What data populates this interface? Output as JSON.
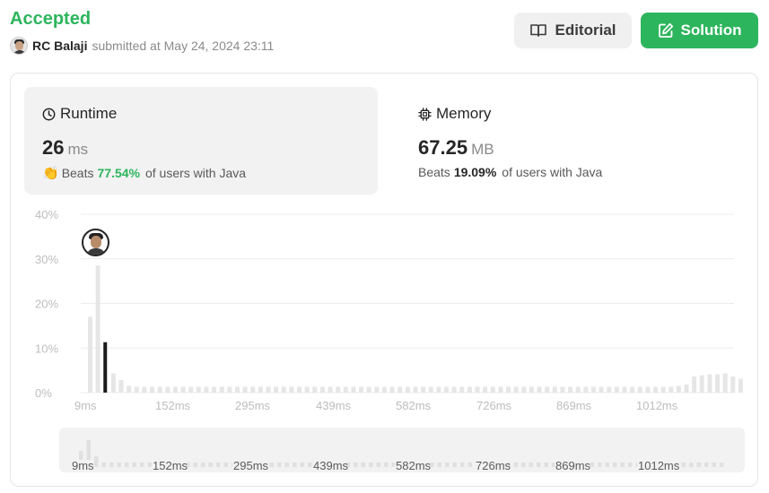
{
  "header": {
    "status": "Accepted",
    "submitter_name": "RC Balaji",
    "submitted_text": "submitted at May 24, 2024 23:11",
    "editorial_label": "Editorial",
    "solution_label": "Solution"
  },
  "runtime": {
    "title": "Runtime",
    "value": "26",
    "unit": "ms",
    "beats_prefix": "Beats",
    "beats_pct": "77.54%",
    "beats_suffix": "of users with Java"
  },
  "memory": {
    "title": "Memory",
    "value": "67.25",
    "unit": "MB",
    "beats_prefix": "Beats",
    "beats_pct": "19.09%",
    "beats_suffix": "of users with Java"
  },
  "colors": {
    "accent_green": "#2db55d",
    "bar_highlight": "#1a1a1a",
    "bar_muted": "#e6e6e6"
  },
  "icons": {
    "editorial": "book-icon",
    "solution": "edit-icon",
    "runtime": "clock-icon",
    "memory": "chip-icon",
    "beats": "clapping-hands-icon"
  },
  "chart_data": {
    "type": "bar",
    "xlabel": "",
    "ylabel": "",
    "ylim": [
      0,
      40
    ],
    "y_ticks": [
      "0%",
      "10%",
      "20%",
      "30%",
      "40%"
    ],
    "x_ticks": [
      "9ms",
      "152ms",
      "295ms",
      "439ms",
      "582ms",
      "726ms",
      "869ms",
      "1012ms"
    ],
    "grid": true,
    "highlight_index": 2,
    "values": [
      17,
      28.5,
      11.3,
      4.3,
      2.8,
      1.5,
      1.3,
      1.3,
      1.3,
      1.3,
      1.3,
      1.3,
      1.3,
      1.3,
      1.3,
      1.3,
      1.3,
      1.3,
      1.3,
      1.3,
      1.3,
      1.3,
      1.3,
      1.3,
      1.3,
      1.3,
      1.3,
      1.3,
      1.3,
      1.3,
      1.3,
      1.3,
      1.3,
      1.3,
      1.3,
      1.3,
      1.3,
      1.3,
      1.3,
      1.3,
      1.3,
      1.3,
      1.3,
      1.3,
      1.3,
      1.3,
      1.3,
      1.3,
      1.3,
      1.3,
      1.3,
      1.3,
      1.3,
      1.3,
      1.3,
      1.3,
      1.3,
      1.3,
      1.3,
      1.3,
      1.3,
      1.3,
      1.3,
      1.3,
      1.3,
      1.3,
      1.3,
      1.3,
      1.3,
      1.3,
      1.3,
      1.3,
      1.3,
      1.3,
      1.3,
      1.3,
      1.5,
      1.8,
      3.6,
      3.9,
      4.1,
      4.1,
      4.3,
      3.6,
      3.1
    ]
  }
}
